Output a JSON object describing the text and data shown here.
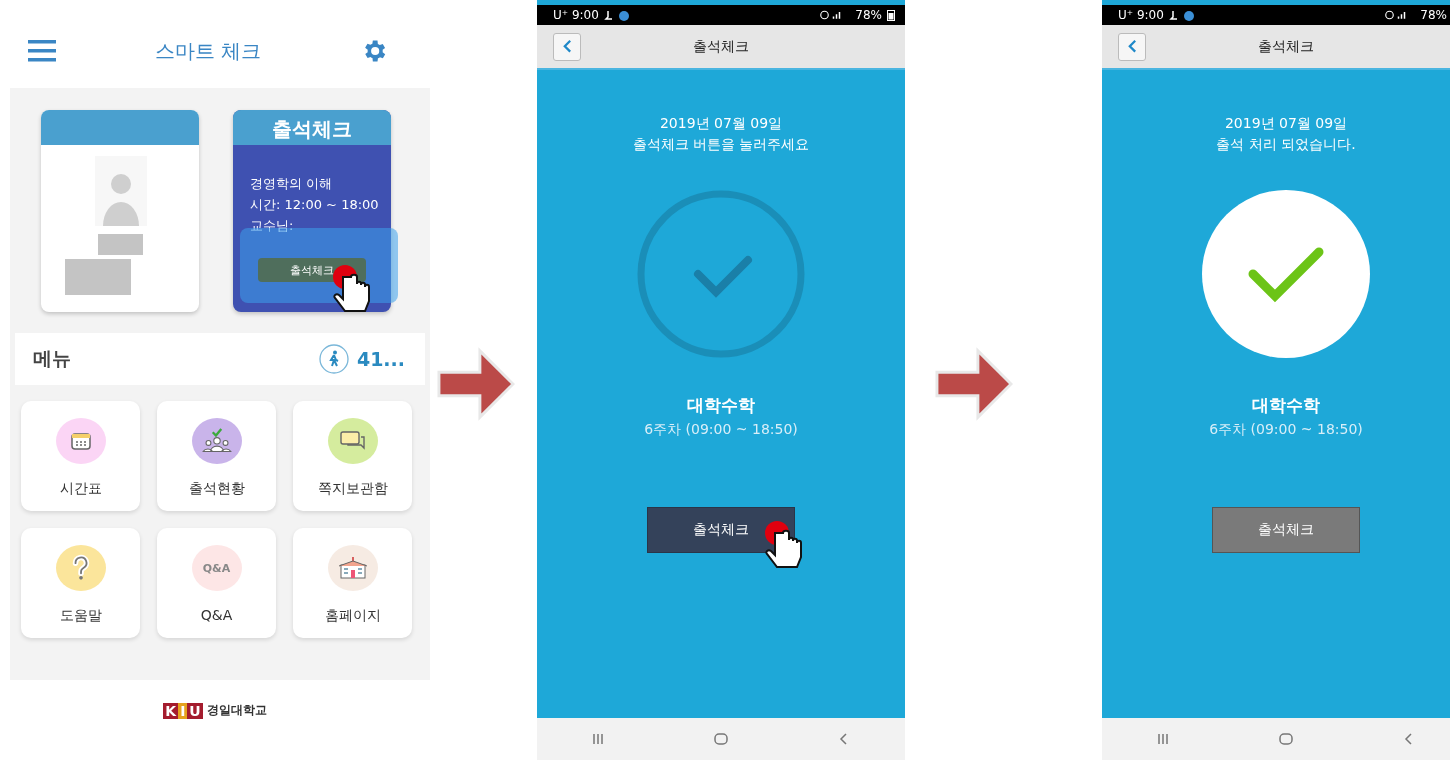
{
  "home_screen": {
    "title": "스마트 체크",
    "attendance_card": {
      "title": "출석체크",
      "course": "경영학의 이해",
      "time": "시간: 12:00 ~ 18:00",
      "professor": "교수님:",
      "button": "출석체크",
      "tapped": true
    },
    "menu": {
      "title": "메뉴",
      "count": "41..."
    },
    "menu_items": [
      {
        "label": "시간표",
        "kind": "calendar",
        "color": "#fbd5f5"
      },
      {
        "label": "출석현황",
        "kind": "people",
        "color": "#c9b4ea"
      },
      {
        "label": "쪽지보관함",
        "kind": "chat",
        "color": "#d5ec9e"
      },
      {
        "label": "도움말",
        "kind": "question",
        "color": "#fbe59b"
      },
      {
        "label": "Q&A",
        "kind": "qa",
        "color": "#fde6e6",
        "icon_text": "Q&A"
      },
      {
        "label": "홈페이지",
        "kind": "building",
        "color": "#f6ebe3"
      }
    ],
    "footer": {
      "logo_letters": [
        "K",
        "I",
        "U"
      ],
      "name": "경일대학교"
    }
  },
  "screens": [
    {
      "status_bar": {
        "carrier": "U⁺",
        "time": "9:00",
        "battery": "78%"
      },
      "title": "출석체크",
      "date": "2019년 07월 09일",
      "message": "출석체크 버튼을 눌러주세요",
      "checked": false,
      "course": "대학수학",
      "session": "6주차 (09:00 ~ 18:50)",
      "button": {
        "label": "출석체크",
        "disabled": false,
        "tapped": true
      }
    },
    {
      "status_bar": {
        "carrier": "U⁺",
        "time": "9:00",
        "battery": "78%"
      },
      "title": "출석체크",
      "date": "2019년 07월 09일",
      "message": "출석 처리 되었습니다.",
      "checked": true,
      "course": "대학수학",
      "session": "6주차 (09:00 ~ 18:50)",
      "button": {
        "label": "출석체크",
        "disabled": true,
        "tapped": false
      }
    }
  ]
}
